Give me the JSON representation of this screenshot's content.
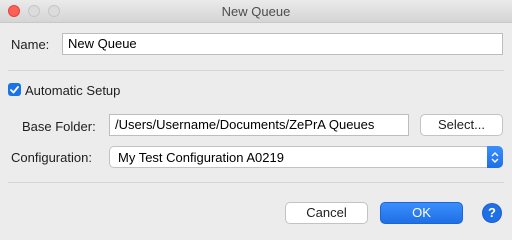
{
  "window": {
    "title": "New Queue"
  },
  "name": {
    "label": "Name:",
    "value": "New Queue"
  },
  "automatic_setup": {
    "label": "Automatic Setup",
    "checked": true
  },
  "base_folder": {
    "label": "Base Folder:",
    "value": "/Users/Username/Documents/ZePrA Queues",
    "select_label": "Select..."
  },
  "configuration": {
    "label": "Configuration:",
    "selected": "My Test Configuration A0219",
    "icon": "up-down-chevron-icon"
  },
  "buttons": {
    "cancel": "Cancel",
    "ok": "OK",
    "help": "?"
  },
  "colors": {
    "accent": "#1f6fe5",
    "close": "#ff5f57"
  }
}
